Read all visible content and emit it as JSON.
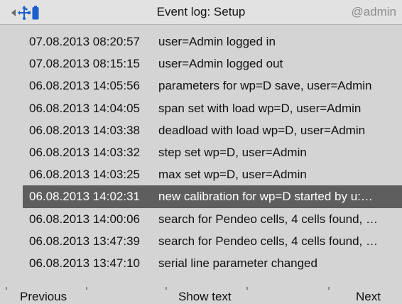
{
  "header": {
    "title": "Event log: Setup",
    "user": "@admin",
    "icons": [
      "arrow-left-icon",
      "network-icon",
      "battery-icon"
    ],
    "icon_color": "#1a5fcc"
  },
  "events": [
    {
      "timestamp": "07.08.2013 08:20:57",
      "message": "user=Admin logged in"
    },
    {
      "timestamp": "07.08.2013 08:15:15",
      "message": "user=Admin logged out"
    },
    {
      "timestamp": "06.08.2013 14:05:56",
      "message": "parameters for wp=D save, user=Admin"
    },
    {
      "timestamp": "06.08.2013 14:04:05",
      "message": "span set with load wp=D, user=Admin"
    },
    {
      "timestamp": "06.08.2013 14:03:38",
      "message": "deadload with load wp=D, user=Admin"
    },
    {
      "timestamp": "06.08.2013 14:03:32",
      "message": "step set wp=D, user=Admin"
    },
    {
      "timestamp": "06.08.2013 14:03:25",
      "message": "max set wp=D, user=Admin"
    },
    {
      "timestamp": "06.08.2013 14:02:31",
      "message": "new calibration for wp=D started by u:…",
      "selected": true
    },
    {
      "timestamp": "06.08.2013 14:00:06",
      "message": "search for Pendeo cells, 4 cells found, …"
    },
    {
      "timestamp": "06.08.2013 13:47:39",
      "message": "search for Pendeo cells, 4 cells found, …"
    },
    {
      "timestamp": "06.08.2013 13:47:10",
      "message": "serial line parameter changed"
    }
  ],
  "softkeys": {
    "previous": "Previous",
    "show_text": "Show text",
    "next": "Next"
  }
}
